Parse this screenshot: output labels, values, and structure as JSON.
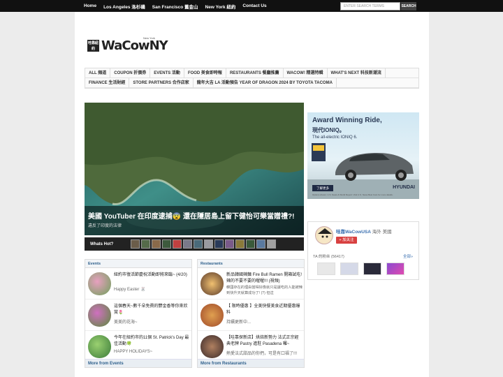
{
  "topnav": {
    "items": [
      "Home",
      "Los Angeles 洛杉磯",
      "San Francisco 舊金山",
      "New York 紐約",
      "Contact Us"
    ],
    "search_placeholder": "ENTER SEARCH TERMS",
    "search_button": "SEARCH"
  },
  "logo": {
    "badge": "哇靠紐約",
    "text": "WaCowNY",
    "sub": "New York"
  },
  "mainnav": {
    "row1": [
      "ALL 頻道",
      "COUPON 折價券",
      "EVENTS 活動",
      "FOOD 美食即時報",
      "RESTAURANTS 餐廳推薦",
      "WACOW! 精選特輯",
      "WHAT'S NEXT 科技新潮流"
    ],
    "row2": [
      "FINANCE 生活財經",
      "STORE PARTNERS 合作店家",
      "龍年大吉 LA 活動預告 YEAR OF DRAGON 2024 BY TOYOTA TACOMA"
    ]
  },
  "hero": {
    "title": "美國 YouTuber 在印度逮捕😨 還在隱居島上留下健怡可樂當贈禮?!",
    "subtitle": "違反了印度的法律"
  },
  "hotbar": {
    "label": "Whats Hot?"
  },
  "ad": {
    "headline": "Award Winning Ride,",
    "brand_line": "現代IONIQ。",
    "tagline": "The all-electric IONIQ 6.",
    "button": "了解更多",
    "brand": "HYUNDAI",
    "fineprint": "Options shown. U.S. News & World Report: Visit U.S. News Best Cars for more details."
  },
  "profile": {
    "name": "哇靠WaCowUSA",
    "location": "海外 美國",
    "follow_button": "+ 加关注",
    "fans_label": "TA 的粉丝 (56417)",
    "all_link": "全部»"
  },
  "events": {
    "header": "Events",
    "footer": "More from Events",
    "items": [
      {
        "title": "紐約市復活節慶祝活動即將來臨~ (4/20)",
        "sub": "Happy Easter 🐰"
      },
      {
        "title": "這個春天~數千朵免費的鬱金香等你來欣賞🌷",
        "sub": "美美的花海~"
      },
      {
        "title": "今年在紐約市的11個 St. Patrick's Day 最佳活動🍀",
        "sub": "HAPPY HOLIDAYS~"
      }
    ]
  },
  "restaurants": {
    "header": "Restaurants",
    "footer": "More from Restaurants",
    "items": [
      {
        "title": "新品韓國辣麵 Fire Bull Ramen 開箱試吃! 辣的不要不要的喔喔!!! (視頻)",
        "sub": "韓國存在的理由當得好像就只是讓吃的人能被辣到快升天就算成功了! (?) 但這"
      },
      {
        "title": "【 限時優惠 】全美快餐美食近期優惠爆料",
        "sub": "持續更新中..."
      },
      {
        "title": "【哇靠探新店】烘焙新勢力 法式正宗經典老牌 Pastry 進駐 Pasadena 囉~",
        "sub": "熱愛法式甜品的你們，可是有口福了!!!"
      }
    ]
  },
  "colors": {
    "topbar": "#111111",
    "accent_blue": "#2d5f8b",
    "follow_red": "#d84040",
    "ad_navy": "#1f2a44"
  }
}
